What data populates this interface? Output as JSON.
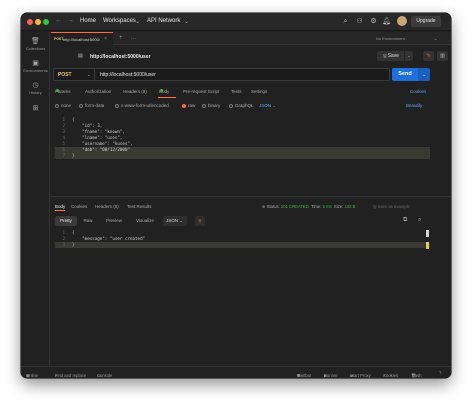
{
  "titlebar": {
    "home": "Home",
    "workspaces": "Workspaces",
    "api_network": "API Network",
    "upgrade": "Upgrade"
  },
  "sidebar": {
    "items": [
      {
        "label": "Collections",
        "icon": "collections-icon"
      },
      {
        "label": "Environments",
        "icon": "environments-icon"
      },
      {
        "label": "History",
        "icon": "history-icon"
      },
      {
        "label": "",
        "icon": "apps-icon"
      }
    ]
  },
  "tab": {
    "method": "POST",
    "title": "http://localhost:5000/",
    "environment": "No Environment"
  },
  "path": {
    "text": "http://localhost:5000/user",
    "save_label": "Save"
  },
  "request": {
    "method": "POST",
    "url": "http://localhost:5000/user",
    "send_label": "Send"
  },
  "request_tabs": {
    "params": "Params",
    "authorization": "Authorization",
    "headers": "Headers (8)",
    "body": "Body",
    "prerequest": "Pre-request Script",
    "tests": "Tests",
    "settings": "Settings",
    "cookies": "Cookies"
  },
  "body_options": {
    "none": "none",
    "form_data": "form-data",
    "urlencoded": "x-www-form-urlencoded",
    "raw": "raw",
    "binary": "binary",
    "graphql": "GraphQL",
    "json": "JSON",
    "beautify": "Beautify"
  },
  "request_body": {
    "lines": [
      "{",
      "    \"id\": 3,",
      "    \"fname\": \"known\",",
      "    \"lname\": \"uses\",",
      "    \"username\": \"kuses\",",
      "    \"dob\": \"08/12/2000\"",
      "}"
    ]
  },
  "response_tabs": {
    "body": "Body",
    "cookies": "Cookies",
    "headers": "Headers (5)",
    "test_results": "Test Results"
  },
  "response_status": {
    "status_label": "Status:",
    "status_value": "201 CREATED",
    "time_label": "Time:",
    "time_value": "6 ms",
    "size_label": "Size:",
    "size_value": "183 B",
    "save_example": "Save as example"
  },
  "response_view": {
    "pretty": "Pretty",
    "raw": "Raw",
    "preview": "Preview",
    "visualize": "Visualize",
    "format": "JSON"
  },
  "response_body": {
    "lines": [
      "{",
      "    \"message\": \"user created\"",
      "}"
    ]
  },
  "statusbar": {
    "online": "Online",
    "find_replace": "Find and replace",
    "console": "Console",
    "postbot": "Postbot",
    "runner": "Runner",
    "start_proxy": "Start Proxy",
    "cookies": "Cookies",
    "trash": "Trash"
  },
  "colors": {
    "accent": "#ff6c37",
    "send": "#1f6fdc",
    "method_post": "#e8c46b",
    "status_ok": "#3fb24f",
    "link": "#5aa0f0"
  }
}
